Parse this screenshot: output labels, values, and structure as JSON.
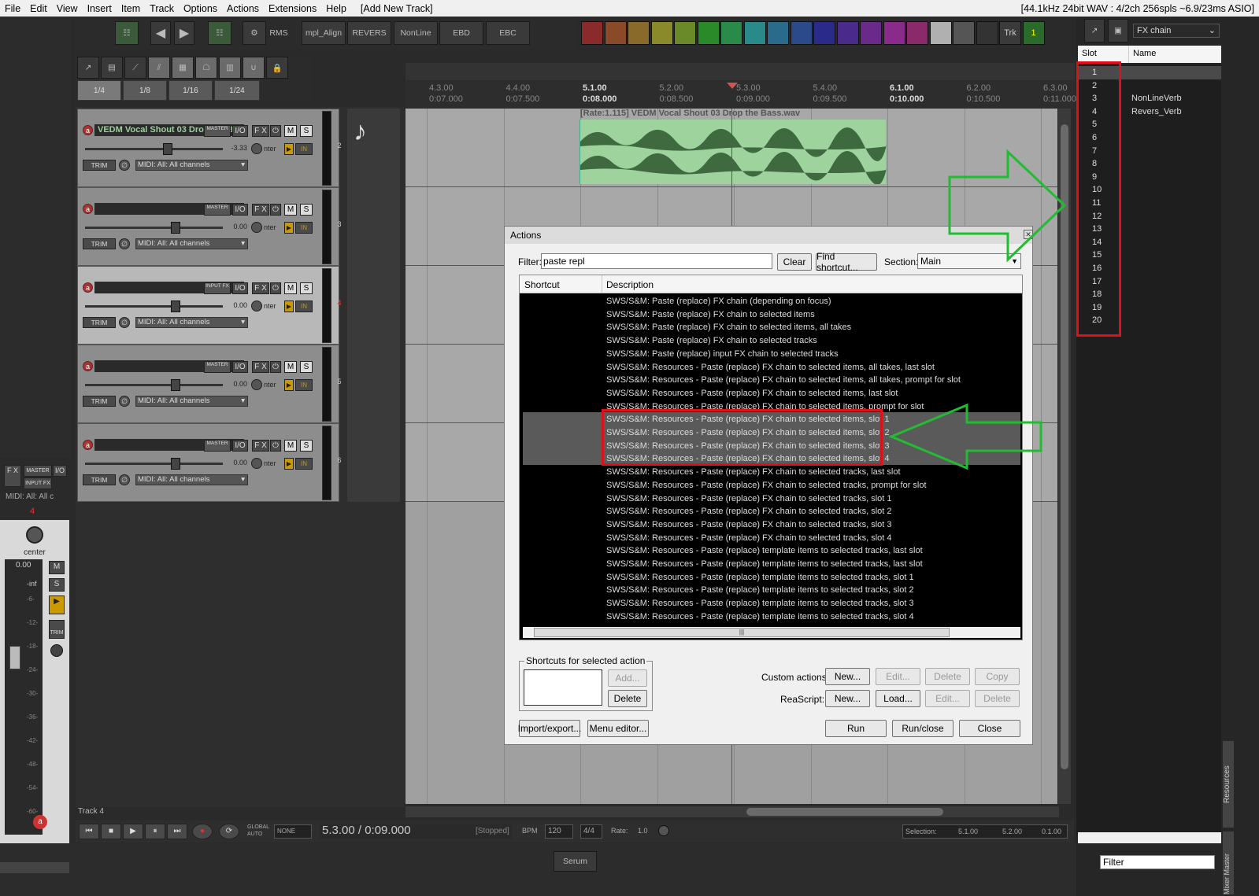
{
  "menubar": {
    "items": [
      "File",
      "Edit",
      "View",
      "Insert",
      "Item",
      "Track",
      "Options",
      "Actions",
      "Extensions",
      "Help"
    ],
    "window_title": "[Add New Track]",
    "status": "[44.1kHz 24bit WAV : 4/2ch 256spls ~6.9/23ms ASIO]"
  },
  "toolbar": {
    "buttons": [
      "RMS",
      "mpl_Align",
      "REVERS",
      "NonLine",
      "EBD",
      "EBC"
    ],
    "trk_label": "Trk",
    "one_label": "1",
    "colors": [
      "#8a2a2a",
      "#8a4a2a",
      "#8a6a2a",
      "#8a8a2a",
      "#6a8a2a",
      "#2a8a2a",
      "#2a8a4a",
      "#2a8a8a",
      "#2a6a8a",
      "#2a4a8a",
      "#2a2a8a",
      "#4a2a8a",
      "#6a2a8a",
      "#8a2a8a",
      "#8a2a6a",
      "#b0b0b0",
      "#555555",
      "#333333"
    ]
  },
  "snap": [
    "1/4",
    "1/8",
    "1/16",
    "1/24"
  ],
  "tracks": [
    {
      "name": "VEDM Vocal Shout 03 Drop the Bass.wav",
      "num": "2",
      "volume": "-3.33",
      "badge": "MASTER",
      "midi": "MIDI: All: All channels",
      "selected": false,
      "fx_label": "F X",
      "io": "I/O",
      "m": "M",
      "s": "S",
      "trim": "TRIM",
      "pan": "nter"
    },
    {
      "name": "",
      "num": "3",
      "volume": "0.00",
      "badge": "MASTER",
      "midi": "MIDI: All: All channels",
      "selected": false,
      "fx_label": "F X",
      "io": "I/O",
      "m": "M",
      "s": "S",
      "trim": "TRIM",
      "pan": "nter"
    },
    {
      "name": "",
      "num": "4",
      "volume": "0.00",
      "badge": "INPUT FX",
      "midi": "MIDI: All: All channels",
      "selected": true,
      "fx_label": "F X",
      "io": "I/O",
      "m": "M",
      "s": "S",
      "trim": "TRIM",
      "pan": "nter"
    },
    {
      "name": "",
      "num": "5",
      "volume": "0.00",
      "badge": "MASTER",
      "midi": "MIDI: All: All channels",
      "selected": false,
      "fx_label": "F X",
      "io": "I/O",
      "m": "M",
      "s": "S",
      "trim": "TRIM",
      "pan": "nter"
    },
    {
      "name": "",
      "num": "6",
      "volume": "0.00",
      "badge": "MASTER",
      "midi": "MIDI: All: All channels",
      "selected": false,
      "fx_label": "F X",
      "io": "I/O",
      "m": "M",
      "s": "S",
      "trim": "TRIM",
      "pan": "nter"
    }
  ],
  "ruler": [
    {
      "bar": "4.3.00",
      "time": "0:07.000",
      "bold": false
    },
    {
      "bar": "4.4.00",
      "time": "0:07.500",
      "bold": false
    },
    {
      "bar": "5.1.00",
      "time": "0:08.000",
      "bold": true
    },
    {
      "bar": "5.2.00",
      "time": "0:08.500",
      "bold": false
    },
    {
      "bar": "5.3.00",
      "time": "0:09.000",
      "bold": false
    },
    {
      "bar": "5.4.00",
      "time": "0:09.500",
      "bold": false
    },
    {
      "bar": "6.1.00",
      "time": "0:10.000",
      "bold": true
    },
    {
      "bar": "6.2.00",
      "time": "0:10.500",
      "bold": false
    },
    {
      "bar": "6.3.00",
      "time": "0:11.000",
      "bold": false
    }
  ],
  "item": {
    "label": "[Rate:1.115] VEDM Vocal Shout 03 Drop the Bass.wav"
  },
  "actions": {
    "title": "Actions",
    "filter_label": "Filter:",
    "filter_value": "paste repl",
    "clear": "Clear",
    "find_shortcut": "Find shortcut...",
    "section_label": "Section:",
    "section_value": "Main",
    "col_shortcut": "Shortcut",
    "col_description": "Description",
    "rows": [
      "SWS/S&M: Paste (replace) FX chain (depending on focus)",
      "SWS/S&M: Paste (replace) FX chain to selected items",
      "SWS/S&M: Paste (replace) FX chain to selected items, all takes",
      "SWS/S&M: Paste (replace) FX chain to selected tracks",
      "SWS/S&M: Paste (replace) input FX chain to selected tracks",
      "SWS/S&M: Resources - Paste (replace) FX chain to selected items, all takes, last slot",
      "SWS/S&M: Resources - Paste (replace) FX chain to selected items, all takes, prompt for slot",
      "SWS/S&M: Resources - Paste (replace) FX chain to selected items, last slot",
      "SWS/S&M: Resources - Paste (replace) FX chain to selected items, prompt for slot",
      "SWS/S&M: Resources - Paste (replace) FX chain to selected items, slot 1",
      "SWS/S&M: Resources - Paste (replace) FX chain to selected items, slot 2",
      "SWS/S&M: Resources - Paste (replace) FX chain to selected items, slot 3",
      "SWS/S&M: Resources - Paste (replace) FX chain to selected items, slot 4",
      "SWS/S&M: Resources - Paste (replace) FX chain to selected tracks, last slot",
      "SWS/S&M: Resources - Paste (replace) FX chain to selected tracks, prompt for slot",
      "SWS/S&M: Resources - Paste (replace) FX chain to selected tracks, slot 1",
      "SWS/S&M: Resources - Paste (replace) FX chain to selected tracks, slot 2",
      "SWS/S&M: Resources - Paste (replace) FX chain to selected tracks, slot 3",
      "SWS/S&M: Resources - Paste (replace) FX chain to selected tracks, slot 4",
      "SWS/S&M: Resources - Paste (replace) template items to selected tracks, last slot",
      "SWS/S&M: Resources - Paste (replace) template items to selected tracks, last slot",
      "SWS/S&M: Resources - Paste (replace) template items to selected tracks, slot 1",
      "SWS/S&M: Resources - Paste (replace) template items to selected tracks, slot 2",
      "SWS/S&M: Resources - Paste (replace) template items to selected tracks, slot 3",
      "SWS/S&M: Resources - Paste (replace) template items to selected tracks, slot 4"
    ],
    "shortcuts_group": "Shortcuts for selected action",
    "add": "Add...",
    "delete": "Delete",
    "custom_actions_label": "Custom actions:",
    "reascript_label": "ReaScript:",
    "new": "New...",
    "edit": "Edit...",
    "copy": "Copy",
    "load": "Load...",
    "import_export": "Import/export...",
    "menu_editor": "Menu editor...",
    "run": "Run",
    "run_close": "Run/close",
    "close": "Close"
  },
  "resources": {
    "type": "FX chain",
    "col_slot": "Slot",
    "col_name": "Name",
    "slots": [
      {
        "slot": "1",
        "name": ""
      },
      {
        "slot": "2",
        "name": ""
      },
      {
        "slot": "3",
        "name": "NonLineVerb"
      },
      {
        "slot": "4",
        "name": "Revers_Verb"
      },
      {
        "slot": "5",
        "name": ""
      },
      {
        "slot": "6",
        "name": ""
      },
      {
        "slot": "7",
        "name": ""
      },
      {
        "slot": "8",
        "name": ""
      },
      {
        "slot": "9",
        "name": ""
      },
      {
        "slot": "10",
        "name": ""
      },
      {
        "slot": "11",
        "name": ""
      },
      {
        "slot": "12",
        "name": ""
      },
      {
        "slot": "13",
        "name": ""
      },
      {
        "slot": "14",
        "name": ""
      },
      {
        "slot": "15",
        "name": ""
      },
      {
        "slot": "16",
        "name": ""
      },
      {
        "slot": "17",
        "name": ""
      },
      {
        "slot": "18",
        "name": ""
      },
      {
        "slot": "19",
        "name": ""
      },
      {
        "slot": "20",
        "name": ""
      }
    ],
    "filter_placeholder": "Filter",
    "side_tab": "Resources",
    "side_tab2": "Mixer Master"
  },
  "mixer": {
    "track_number": "4",
    "pan": "center",
    "volume": "0.00",
    "inf": "-inf",
    "midi": "MIDI: All: All c",
    "scale": [
      "-6-",
      "-12-",
      "-18-",
      "-24-",
      "-30-",
      "-36-",
      "-42-",
      "-48-",
      "-54-",
      "-60-"
    ],
    "trim": "TRIM",
    "master": "MASTER",
    "inputfx": "INPUT FX",
    "io": "I/O",
    "fx": "F X",
    "m": "M",
    "s": "S"
  },
  "status": {
    "track_label": "Track 4"
  },
  "transport": {
    "position": "5.3.00 / 0:09.000",
    "state": "[Stopped]",
    "bpm_label": "BPM",
    "bpm": "120",
    "timesig": "4/4",
    "rate_label": "Rate:",
    "rate": "1.0",
    "global_auto": "GLOBAL AUTO",
    "auto_mode": "NONE",
    "selection_label": "Selection:",
    "sel_start": "5.1.00",
    "sel_end": "5.2.00",
    "sel_len": "0.1.00"
  },
  "bottom": {
    "serum": "Serum"
  },
  "annotation_colors": {
    "red": "#e0101a",
    "green": "#22bb33"
  }
}
